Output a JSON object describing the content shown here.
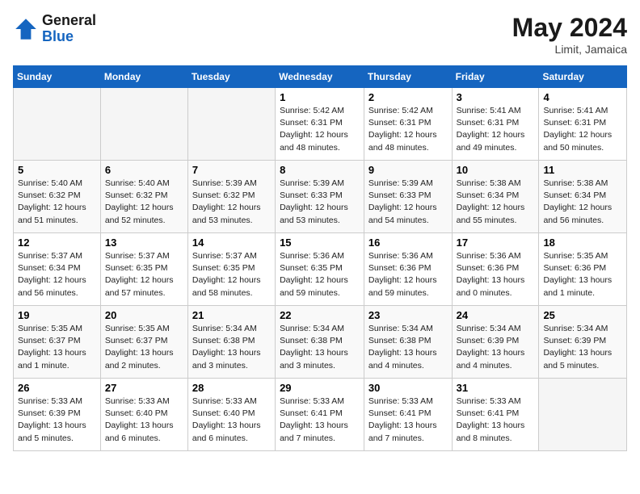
{
  "header": {
    "logo_general": "General",
    "logo_blue": "Blue",
    "month_year": "May 2024",
    "location": "Limit, Jamaica"
  },
  "weekdays": [
    "Sunday",
    "Monday",
    "Tuesday",
    "Wednesday",
    "Thursday",
    "Friday",
    "Saturday"
  ],
  "weeks": [
    [
      {
        "day": "",
        "info": ""
      },
      {
        "day": "",
        "info": ""
      },
      {
        "day": "",
        "info": ""
      },
      {
        "day": "1",
        "info": "Sunrise: 5:42 AM\nSunset: 6:31 PM\nDaylight: 12 hours\nand 48 minutes."
      },
      {
        "day": "2",
        "info": "Sunrise: 5:42 AM\nSunset: 6:31 PM\nDaylight: 12 hours\nand 48 minutes."
      },
      {
        "day": "3",
        "info": "Sunrise: 5:41 AM\nSunset: 6:31 PM\nDaylight: 12 hours\nand 49 minutes."
      },
      {
        "day": "4",
        "info": "Sunrise: 5:41 AM\nSunset: 6:31 PM\nDaylight: 12 hours\nand 50 minutes."
      }
    ],
    [
      {
        "day": "5",
        "info": "Sunrise: 5:40 AM\nSunset: 6:32 PM\nDaylight: 12 hours\nand 51 minutes."
      },
      {
        "day": "6",
        "info": "Sunrise: 5:40 AM\nSunset: 6:32 PM\nDaylight: 12 hours\nand 52 minutes."
      },
      {
        "day": "7",
        "info": "Sunrise: 5:39 AM\nSunset: 6:32 PM\nDaylight: 12 hours\nand 53 minutes."
      },
      {
        "day": "8",
        "info": "Sunrise: 5:39 AM\nSunset: 6:33 PM\nDaylight: 12 hours\nand 53 minutes."
      },
      {
        "day": "9",
        "info": "Sunrise: 5:39 AM\nSunset: 6:33 PM\nDaylight: 12 hours\nand 54 minutes."
      },
      {
        "day": "10",
        "info": "Sunrise: 5:38 AM\nSunset: 6:34 PM\nDaylight: 12 hours\nand 55 minutes."
      },
      {
        "day": "11",
        "info": "Sunrise: 5:38 AM\nSunset: 6:34 PM\nDaylight: 12 hours\nand 56 minutes."
      }
    ],
    [
      {
        "day": "12",
        "info": "Sunrise: 5:37 AM\nSunset: 6:34 PM\nDaylight: 12 hours\nand 56 minutes."
      },
      {
        "day": "13",
        "info": "Sunrise: 5:37 AM\nSunset: 6:35 PM\nDaylight: 12 hours\nand 57 minutes."
      },
      {
        "day": "14",
        "info": "Sunrise: 5:37 AM\nSunset: 6:35 PM\nDaylight: 12 hours\nand 58 minutes."
      },
      {
        "day": "15",
        "info": "Sunrise: 5:36 AM\nSunset: 6:35 PM\nDaylight: 12 hours\nand 59 minutes."
      },
      {
        "day": "16",
        "info": "Sunrise: 5:36 AM\nSunset: 6:36 PM\nDaylight: 12 hours\nand 59 minutes."
      },
      {
        "day": "17",
        "info": "Sunrise: 5:36 AM\nSunset: 6:36 PM\nDaylight: 13 hours\nand 0 minutes."
      },
      {
        "day": "18",
        "info": "Sunrise: 5:35 AM\nSunset: 6:36 PM\nDaylight: 13 hours\nand 1 minute."
      }
    ],
    [
      {
        "day": "19",
        "info": "Sunrise: 5:35 AM\nSunset: 6:37 PM\nDaylight: 13 hours\nand 1 minute."
      },
      {
        "day": "20",
        "info": "Sunrise: 5:35 AM\nSunset: 6:37 PM\nDaylight: 13 hours\nand 2 minutes."
      },
      {
        "day": "21",
        "info": "Sunrise: 5:34 AM\nSunset: 6:38 PM\nDaylight: 13 hours\nand 3 minutes."
      },
      {
        "day": "22",
        "info": "Sunrise: 5:34 AM\nSunset: 6:38 PM\nDaylight: 13 hours\nand 3 minutes."
      },
      {
        "day": "23",
        "info": "Sunrise: 5:34 AM\nSunset: 6:38 PM\nDaylight: 13 hours\nand 4 minutes."
      },
      {
        "day": "24",
        "info": "Sunrise: 5:34 AM\nSunset: 6:39 PM\nDaylight: 13 hours\nand 4 minutes."
      },
      {
        "day": "25",
        "info": "Sunrise: 5:34 AM\nSunset: 6:39 PM\nDaylight: 13 hours\nand 5 minutes."
      }
    ],
    [
      {
        "day": "26",
        "info": "Sunrise: 5:33 AM\nSunset: 6:39 PM\nDaylight: 13 hours\nand 5 minutes."
      },
      {
        "day": "27",
        "info": "Sunrise: 5:33 AM\nSunset: 6:40 PM\nDaylight: 13 hours\nand 6 minutes."
      },
      {
        "day": "28",
        "info": "Sunrise: 5:33 AM\nSunset: 6:40 PM\nDaylight: 13 hours\nand 6 minutes."
      },
      {
        "day": "29",
        "info": "Sunrise: 5:33 AM\nSunset: 6:41 PM\nDaylight: 13 hours\nand 7 minutes."
      },
      {
        "day": "30",
        "info": "Sunrise: 5:33 AM\nSunset: 6:41 PM\nDaylight: 13 hours\nand 7 minutes."
      },
      {
        "day": "31",
        "info": "Sunrise: 5:33 AM\nSunset: 6:41 PM\nDaylight: 13 hours\nand 8 minutes."
      },
      {
        "day": "",
        "info": ""
      }
    ]
  ]
}
